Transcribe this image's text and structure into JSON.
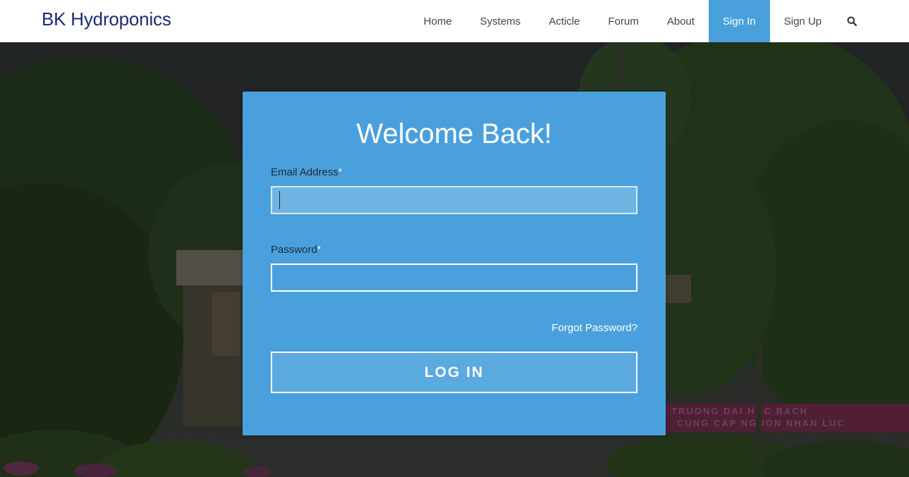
{
  "header": {
    "brand": "BK Hydroponics",
    "nav": [
      {
        "label": "Home"
      },
      {
        "label": "Systems"
      },
      {
        "label": "Acticle"
      },
      {
        "label": "Forum"
      },
      {
        "label": "About"
      },
      {
        "label": "Sign In",
        "active": true
      },
      {
        "label": "Sign Up"
      }
    ],
    "search_icon": "search-icon"
  },
  "login": {
    "title": "Welcome Back!",
    "email_label": "Email Address",
    "email_value": "",
    "password_label": "Password",
    "password_value": "",
    "required_marker": "*",
    "forgot_label": "Forgot Password?",
    "submit_label": "LOG IN"
  },
  "background": {
    "banner_text_line1": "TRUONG DAI HOC BACH",
    "banner_text_line2": "CUNG CAP NGUON NHAN LUC"
  },
  "colors": {
    "accent": "#4aa0dc",
    "brand": "#1d2a78",
    "header_bg": "#ffffff"
  }
}
